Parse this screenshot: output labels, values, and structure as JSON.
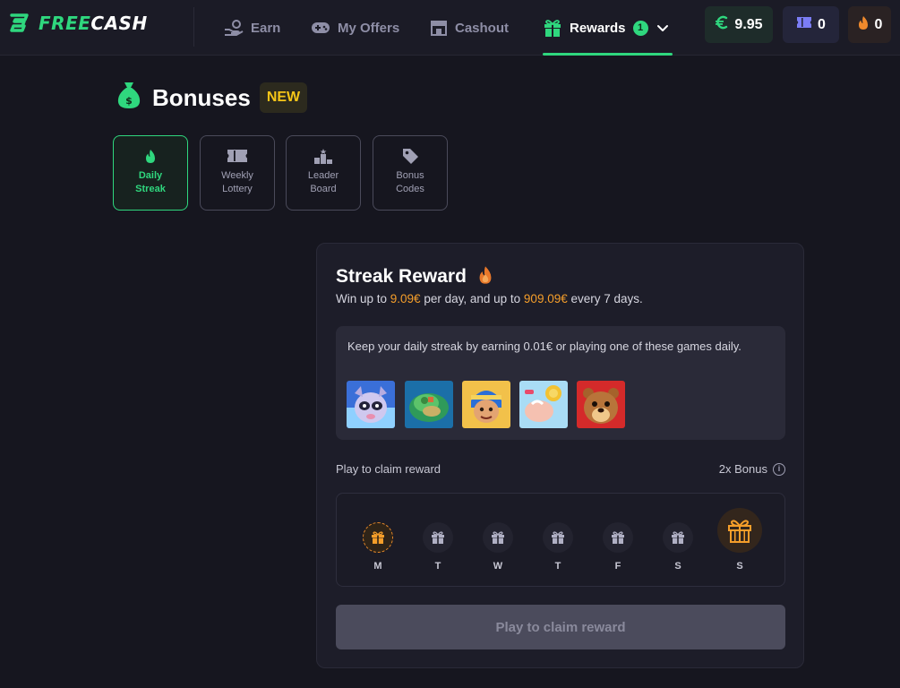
{
  "header": {
    "logo": {
      "free": "FREE",
      "cash": "CASH"
    },
    "nav": [
      {
        "label": "Earn",
        "icon": "hand-coin-icon"
      },
      {
        "label": "My Offers",
        "icon": "gamepad-icon"
      },
      {
        "label": "Cashout",
        "icon": "store-icon"
      },
      {
        "label": "Rewards",
        "icon": "gift-icon",
        "badge": "1",
        "active": true
      }
    ],
    "balance": "9.95",
    "tickets": "0",
    "streak_count": "0"
  },
  "page": {
    "title": "Bonuses",
    "badge": "NEW"
  },
  "tabs": [
    {
      "label": "Daily\nStreak",
      "icon": "flame-icon",
      "active": true
    },
    {
      "label": "Weekly\nLottery",
      "icon": "ticket-icon"
    },
    {
      "label": "Leader\nBoard",
      "icon": "podium-icon"
    },
    {
      "label": "Bonus\nCodes",
      "icon": "tag-icon"
    }
  ],
  "streak_card": {
    "title": "Streak Reward",
    "subtitle_prefix": "Win up to ",
    "per_day": "9.09€",
    "subtitle_middle": " per day, and up to ",
    "per_week": "909.09€",
    "subtitle_suffix": " every 7 days.",
    "games_text": "Keep your daily streak by earning 0.01€ or playing one of these games daily.",
    "games": [
      "game-thumbnail-1",
      "game-thumbnail-2",
      "game-thumbnail-3",
      "game-thumbnail-4",
      "game-thumbnail-5"
    ],
    "claim_label": "Play to claim reward",
    "bonus_label": "2x Bonus",
    "days": [
      "M",
      "T",
      "W",
      "T",
      "F",
      "S",
      "S"
    ],
    "button_label": "Play to claim reward"
  },
  "colors": {
    "accent_green": "#2fd77e",
    "accent_orange": "#f59e2a",
    "new_badge_yellow": "#f5c518"
  }
}
